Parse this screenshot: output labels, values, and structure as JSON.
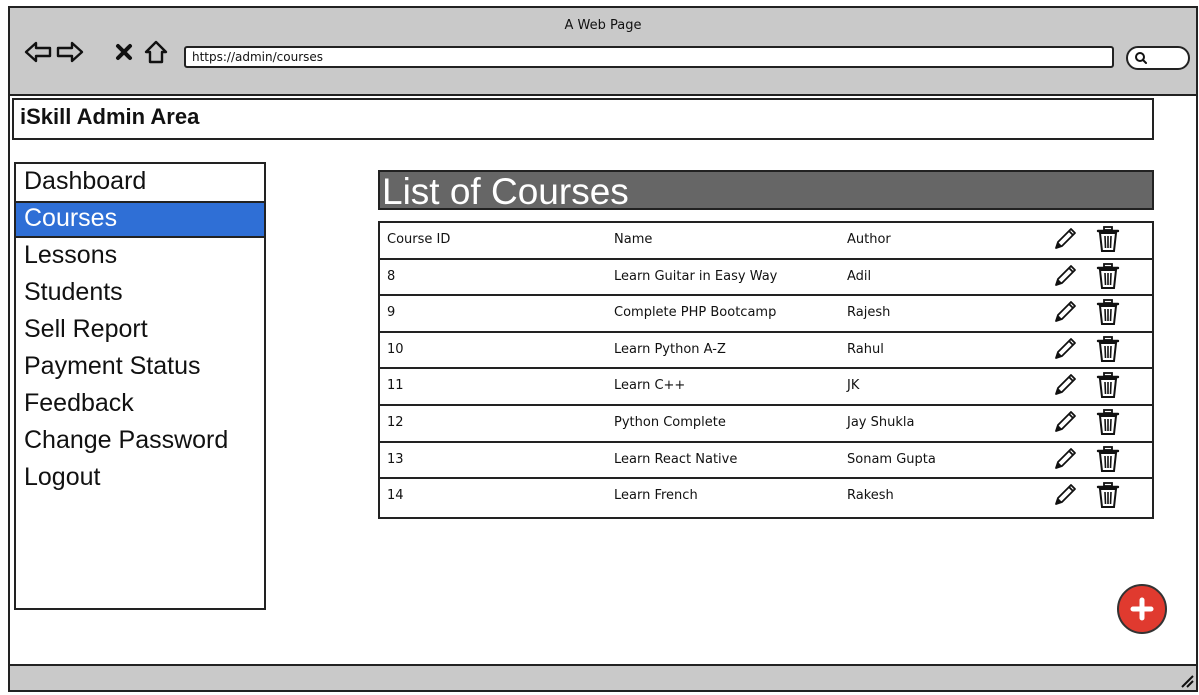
{
  "browser": {
    "window_title": "A Web Page",
    "url": "https://admin/courses",
    "icons": [
      "back-arrow-icon",
      "forward-arrow-icon",
      "close-icon",
      "home-icon",
      "search-icon"
    ]
  },
  "header": {
    "title": "iSkill Admin Area"
  },
  "sidebar": {
    "items": [
      {
        "label": "Dashboard",
        "active": false
      },
      {
        "label": "Courses",
        "active": true
      },
      {
        "label": "Lessons",
        "active": false
      },
      {
        "label": "Students",
        "active": false
      },
      {
        "label": "Sell Report",
        "active": false
      },
      {
        "label": "Payment Status",
        "active": false
      },
      {
        "label": "Feedback",
        "active": false
      },
      {
        "label": "Change Password",
        "active": false
      },
      {
        "label": "Logout",
        "active": false
      }
    ],
    "active_color": "#2f6fd6"
  },
  "main": {
    "section_title": "List of Courses",
    "table": {
      "columns": [
        "Course ID",
        "Name",
        "Author"
      ],
      "rows": [
        {
          "id": "8",
          "name": "Learn Guitar in Easy Way",
          "author": "Adil"
        },
        {
          "id": "9",
          "name": "Complete PHP Bootcamp",
          "author": "Rajesh"
        },
        {
          "id": "10",
          "name": "Learn Python A-Z",
          "author": "Rahul"
        },
        {
          "id": "11",
          "name": "Learn C++",
          "author": "JK"
        },
        {
          "id": "12",
          "name": "Python Complete",
          "author": "Jay Shukla"
        },
        {
          "id": "13",
          "name": "Learn React Native",
          "author": "Sonam Gupta"
        },
        {
          "id": "14",
          "name": "Learn French",
          "author": "Rakesh"
        }
      ],
      "row_actions": [
        "pencil-icon",
        "trash-icon"
      ]
    },
    "add_button": {
      "icon": "plus-icon",
      "color": "#e03a2f"
    }
  }
}
